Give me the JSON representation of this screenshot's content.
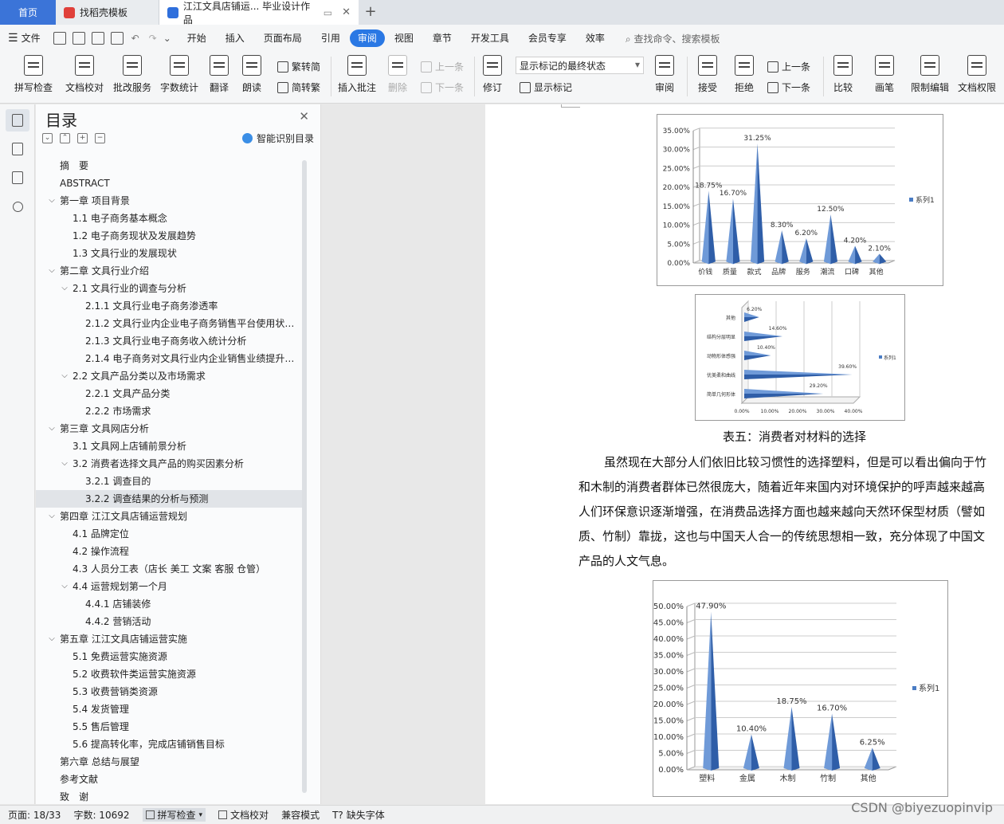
{
  "tabs": {
    "home": "首页",
    "template_tab": "找稻壳模板",
    "doc_tab": "江江文具店铺运... 毕业设计作品"
  },
  "menu": {
    "file": "文件",
    "items": [
      "开始",
      "插入",
      "页面布局",
      "引用",
      "审阅",
      "视图",
      "章节",
      "开发工具",
      "会员专享",
      "效率"
    ],
    "active": "审阅",
    "search": "查找命令、搜索模板"
  },
  "ribbon": {
    "spell": "拼写检查",
    "proof": "文档校对",
    "batch": "批改服务",
    "wordcount": "字数统计",
    "translate": "翻译",
    "read": "朗读",
    "s2t": "繁转简",
    "t2s": "简转繁",
    "insert_comment": "插入批注",
    "delete": "删除",
    "prev": "上一条",
    "next": "下一条",
    "revise": "修订",
    "markup_state": "显示标记的最终状态",
    "show_markup": "显示标记",
    "review": "审阅",
    "accept": "接受",
    "reject": "拒绝",
    "prev2": "上一条",
    "next2": "下一条",
    "compare": "比较",
    "pen": "画笔",
    "restrict": "限制编辑",
    "permission": "文档权限"
  },
  "toc": {
    "title": "目录",
    "smart": "智能识别目录",
    "items": [
      {
        "label": "摘　要",
        "level": 0,
        "toggle": ""
      },
      {
        "label": "ABSTRACT",
        "level": 0,
        "toggle": ""
      },
      {
        "label": "第一章  项目背景",
        "level": 0,
        "toggle": "⌵"
      },
      {
        "label": "1.1 电子商务基本概念",
        "level": 1,
        "toggle": ""
      },
      {
        "label": "1.2 电子商务现状及发展趋势",
        "level": 1,
        "toggle": ""
      },
      {
        "label": "1.3 文具行业的发展现状",
        "level": 1,
        "toggle": ""
      },
      {
        "label": "第二章  文具行业介绍",
        "level": 0,
        "toggle": "⌵"
      },
      {
        "label": "2.1 文具行业的调查与分析",
        "level": 1,
        "toggle": "⌵"
      },
      {
        "label": "2.1.1 文具行业电子商务渗透率",
        "level": 2,
        "toggle": ""
      },
      {
        "label": "2.1.2 文具行业内企业电子商务销售平台使用状况分析",
        "level": 2,
        "toggle": ""
      },
      {
        "label": "2.1.3 文具行业电子商务收入统计分析",
        "level": 2,
        "toggle": ""
      },
      {
        "label": "2.1.4 电子商务对文具行业内企业销售业绩提升作用分析",
        "level": 2,
        "toggle": ""
      },
      {
        "label": "2.2 文具产品分类以及市场需求",
        "level": 1,
        "toggle": "⌵"
      },
      {
        "label": "2.2.1 文具产品分类",
        "level": 2,
        "toggle": ""
      },
      {
        "label": "2.2.2 市场需求",
        "level": 2,
        "toggle": ""
      },
      {
        "label": "第三章  文具网店分析",
        "level": 0,
        "toggle": "⌵"
      },
      {
        "label": "3.1 文具网上店铺前景分析",
        "level": 1,
        "toggle": ""
      },
      {
        "label": "3.2 消费者选择文具产品的购买因素分析",
        "level": 1,
        "toggle": "⌵"
      },
      {
        "label": "3.2.1 调查目的",
        "level": 2,
        "toggle": ""
      },
      {
        "label": "3.2.2 调查结果的分析与预测",
        "level": 2,
        "toggle": "",
        "selected": true
      },
      {
        "label": "第四章  江江文具店铺运营规划",
        "level": 0,
        "toggle": "⌵"
      },
      {
        "label": "4.1 品牌定位",
        "level": 1,
        "toggle": ""
      },
      {
        "label": "4.2 操作流程",
        "level": 1,
        "toggle": ""
      },
      {
        "label": "4.3 人员分工表（店长  美工  文案  客服  仓管）",
        "level": 1,
        "toggle": ""
      },
      {
        "label": "4.4 运营规划第一个月",
        "level": 1,
        "toggle": "⌵"
      },
      {
        "label": "4.4.1 店铺装修",
        "level": 2,
        "toggle": ""
      },
      {
        "label": "4.4.2 营销活动",
        "level": 2,
        "toggle": ""
      },
      {
        "label": "第五章  江江文具店铺运营实施",
        "level": 0,
        "toggle": "⌵"
      },
      {
        "label": "5.1 免费运营实施资源",
        "level": 1,
        "toggle": ""
      },
      {
        "label": "5.2 收费软件类运营实施资源",
        "level": 1,
        "toggle": ""
      },
      {
        "label": "5.3 收费营销类资源",
        "level": 1,
        "toggle": ""
      },
      {
        "label": "5.4 发货管理",
        "level": 1,
        "toggle": ""
      },
      {
        "label": "5.5 售后管理",
        "level": 1,
        "toggle": ""
      },
      {
        "label": "5.6 提高转化率，完成店铺销售目标",
        "level": 1,
        "toggle": ""
      },
      {
        "label": "第六章  总结与展望",
        "level": 0,
        "toggle": ""
      },
      {
        "label": "参考文献",
        "level": 0,
        "toggle": ""
      },
      {
        "label": "致　谢",
        "level": 0,
        "toggle": ""
      }
    ]
  },
  "document": {
    "caption": "表五：消费者对材料的选择",
    "paragraph": [
      "虽然现在大部分人们依旧比较习惯性的选择塑料，但是可以看出偏向于竹",
      "和木制的消费者群体已然很庞大，随着近年来国内对环境保护的呼声越来越高",
      "人们环保意识逐渐增强，在消费品选择方面也越来越向天然环保型材质（譬如",
      "质、竹制）靠拢，这也与中国天人合一的传统思想相一致，充分体现了中国文",
      "产品的人文气息。"
    ]
  },
  "chart_data": [
    {
      "type": "bar",
      "title": "",
      "categories": [
        "价钱",
        "质量",
        "款式",
        "品牌",
        "服务",
        "潮流",
        "口碑",
        "其他"
      ],
      "series": [
        {
          "name": "系列1",
          "values": [
            18.75,
            16.7,
            31.25,
            8.3,
            6.2,
            12.5,
            4.2,
            2.1
          ]
        }
      ],
      "data_labels": [
        "18.75%",
        "16.70%",
        "31.25%",
        "8.30%",
        "6.20%",
        "12.50%",
        "4.20%",
        "2.10%"
      ],
      "ylim": [
        0,
        35
      ],
      "yticks": [
        "0.00%",
        "5.00%",
        "10.00%",
        "15.00%",
        "20.00%",
        "25.00%",
        "30.00%",
        "35.00%"
      ],
      "legend": "right",
      "grid": true,
      "color": "#4a7cc4"
    },
    {
      "type": "bar",
      "orientation": "horizontal",
      "title": "",
      "categories": [
        "简单几何形体",
        "优美柔和曲线",
        "动物形体感强",
        "结构分层明显",
        "其他"
      ],
      "series": [
        {
          "name": "系列1",
          "values": [
            29.2,
            39.6,
            10.4,
            14.6,
            6.2
          ]
        }
      ],
      "data_labels": [
        "29.20%",
        "39.60%",
        "10.40%",
        "14.60%",
        "6.20%"
      ],
      "xlim": [
        0,
        40
      ],
      "xticks": [
        "0.00%",
        "10.00%",
        "20.00%",
        "30.00%",
        "40.00%"
      ],
      "legend": "right",
      "grid": true,
      "color": "#4a7cc4"
    },
    {
      "type": "bar",
      "title": "",
      "categories": [
        "塑料",
        "金属",
        "木制",
        "竹制",
        "其他"
      ],
      "series": [
        {
          "name": "系列1",
          "values": [
            47.9,
            10.4,
            18.75,
            16.7,
            6.25
          ]
        }
      ],
      "data_labels": [
        "47.90%",
        "10.40%",
        "18.75%",
        "16.70%",
        "6.25%"
      ],
      "ylim": [
        0,
        50
      ],
      "yticks": [
        "0.00%",
        "5.00%",
        "10.00%",
        "15.00%",
        "20.00%",
        "25.00%",
        "30.00%",
        "35.00%",
        "40.00%",
        "45.00%",
        "50.00%"
      ],
      "legend": "right",
      "grid": true,
      "color": "#4a7cc4"
    }
  ],
  "status": {
    "page": "页面: 18/33",
    "words": "字数: 10692",
    "spell": "拼写检查",
    "proof": "文档校对",
    "compat": "兼容模式",
    "missing_font": "缺失字体"
  },
  "watermark": "CSDN @biyezuopinvip"
}
